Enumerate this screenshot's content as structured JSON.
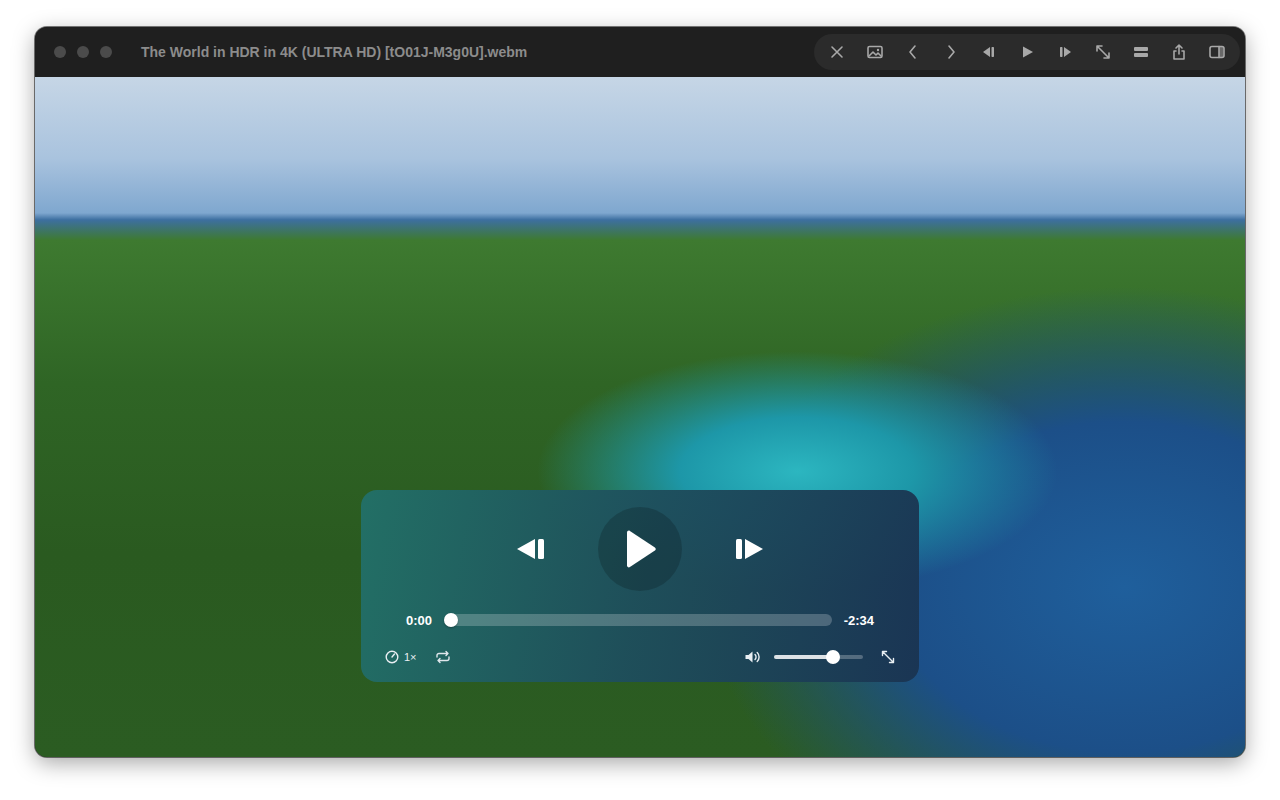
{
  "window": {
    "title": "The World in HDR in 4K (ULTRA HD) [tO01J-M3g0U].webm"
  },
  "player": {
    "playing": false,
    "elapsed": "0:00",
    "remaining": "-2:34",
    "progress": 0,
    "speed": "1×",
    "loop": false,
    "volume": 0.66
  }
}
